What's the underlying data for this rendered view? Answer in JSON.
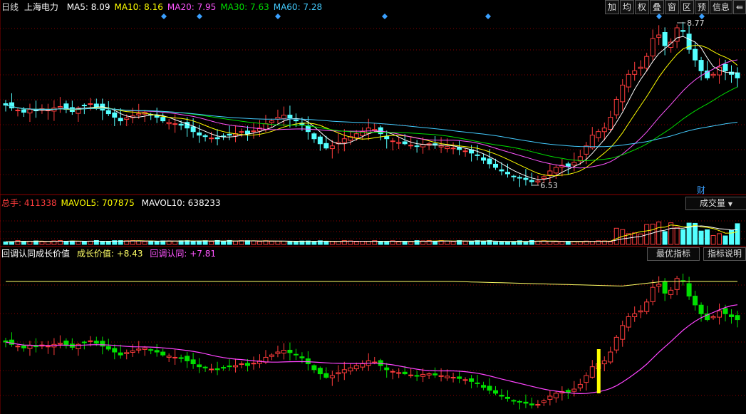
{
  "price_panel": {
    "period": "日线",
    "stock_name": "上海电力",
    "ma": [
      {
        "label": "MA5:",
        "value": "8.09",
        "color": "#ffffff"
      },
      {
        "label": "MA10:",
        "value": "8.16",
        "color": "#ffff00"
      },
      {
        "label": "MA20:",
        "value": "7.95",
        "color": "#ff55ff"
      },
      {
        "label": "MA30:",
        "value": "7.63",
        "color": "#00dd00"
      },
      {
        "label": "MA60:",
        "value": "7.28",
        "color": "#44ccff"
      }
    ],
    "high_label": "8.77",
    "low_label": "6.53",
    "finance_tag": "财"
  },
  "toolbar": {
    "buttons": [
      "加",
      "均",
      "权",
      "叠",
      "窗",
      "区",
      "预",
      "信息"
    ],
    "exit_icon": "exit-icon"
  },
  "volume_panel": {
    "total_label": "总手:",
    "total_value": "411338",
    "mavol5_label": "MAVOL5:",
    "mavol5_value": "707875",
    "mavol10_label": "MAVOL10:",
    "mavol10_value": "638233",
    "selector": "成交量"
  },
  "indicator_panel": {
    "name": "回调认同成长价值",
    "growth_label": "成长价值:",
    "growth_value": "+8.43",
    "pullback_label": "回调认同:",
    "pullback_value": "+7.81",
    "best_button": "最优指标",
    "explain_button": "指标说明"
  },
  "colors": {
    "up": "#ff3c3c",
    "down": "#54ffff",
    "grid": "#8b0000",
    "ind_up": "#ff3c3c",
    "ind_down": "#00e000"
  },
  "chart_data": {
    "type": "candlestick",
    "price_range": [
      6.53,
      8.77
    ],
    "volume_summary": {
      "total": 411338,
      "mavol5": 707875,
      "mavol10": 638233
    },
    "indicator_summary": {
      "growth_value": 8.43,
      "pullback_value": 7.81
    },
    "close_series": [
      7.62,
      7.58,
      7.55,
      7.52,
      7.56,
      7.54,
      7.57,
      7.55,
      7.58,
      7.6,
      7.56,
      7.53,
      7.58,
      7.61,
      7.64,
      7.6,
      7.55,
      7.5,
      7.45,
      7.4,
      7.44,
      7.47,
      7.5,
      7.52,
      7.49,
      7.45,
      7.4,
      7.38,
      7.36,
      7.34,
      7.3,
      7.25,
      7.2,
      7.18,
      7.16,
      7.15,
      7.18,
      7.2,
      7.22,
      7.25,
      7.22,
      7.26,
      7.3,
      7.36,
      7.4,
      7.45,
      7.48,
      7.44,
      7.4,
      7.35,
      7.25,
      7.15,
      7.08,
      7.02,
      7.05,
      7.1,
      7.15,
      7.18,
      7.22,
      7.25,
      7.3,
      7.28,
      7.22,
      7.15,
      7.12,
      7.1,
      7.08,
      7.06,
      7.05,
      7.07,
      7.08,
      7.06,
      7.05,
      7.04,
      7.02,
      7.0,
      6.98,
      6.95,
      6.92,
      6.85,
      6.8,
      6.75,
      6.7,
      6.66,
      6.62,
      6.6,
      6.58,
      6.55,
      6.56,
      6.62,
      6.7,
      6.75,
      6.78,
      6.76,
      6.82,
      6.9,
      7.05,
      7.2,
      7.25,
      7.3,
      7.45,
      7.7,
      7.9,
      8.05,
      8.1,
      8.15,
      8.3,
      8.55,
      8.6,
      8.45,
      8.5,
      8.7,
      8.65,
      8.4,
      8.25,
      8.1,
      8.0,
      8.05,
      8.15,
      8.1,
      8.05,
      8.0
    ]
  }
}
